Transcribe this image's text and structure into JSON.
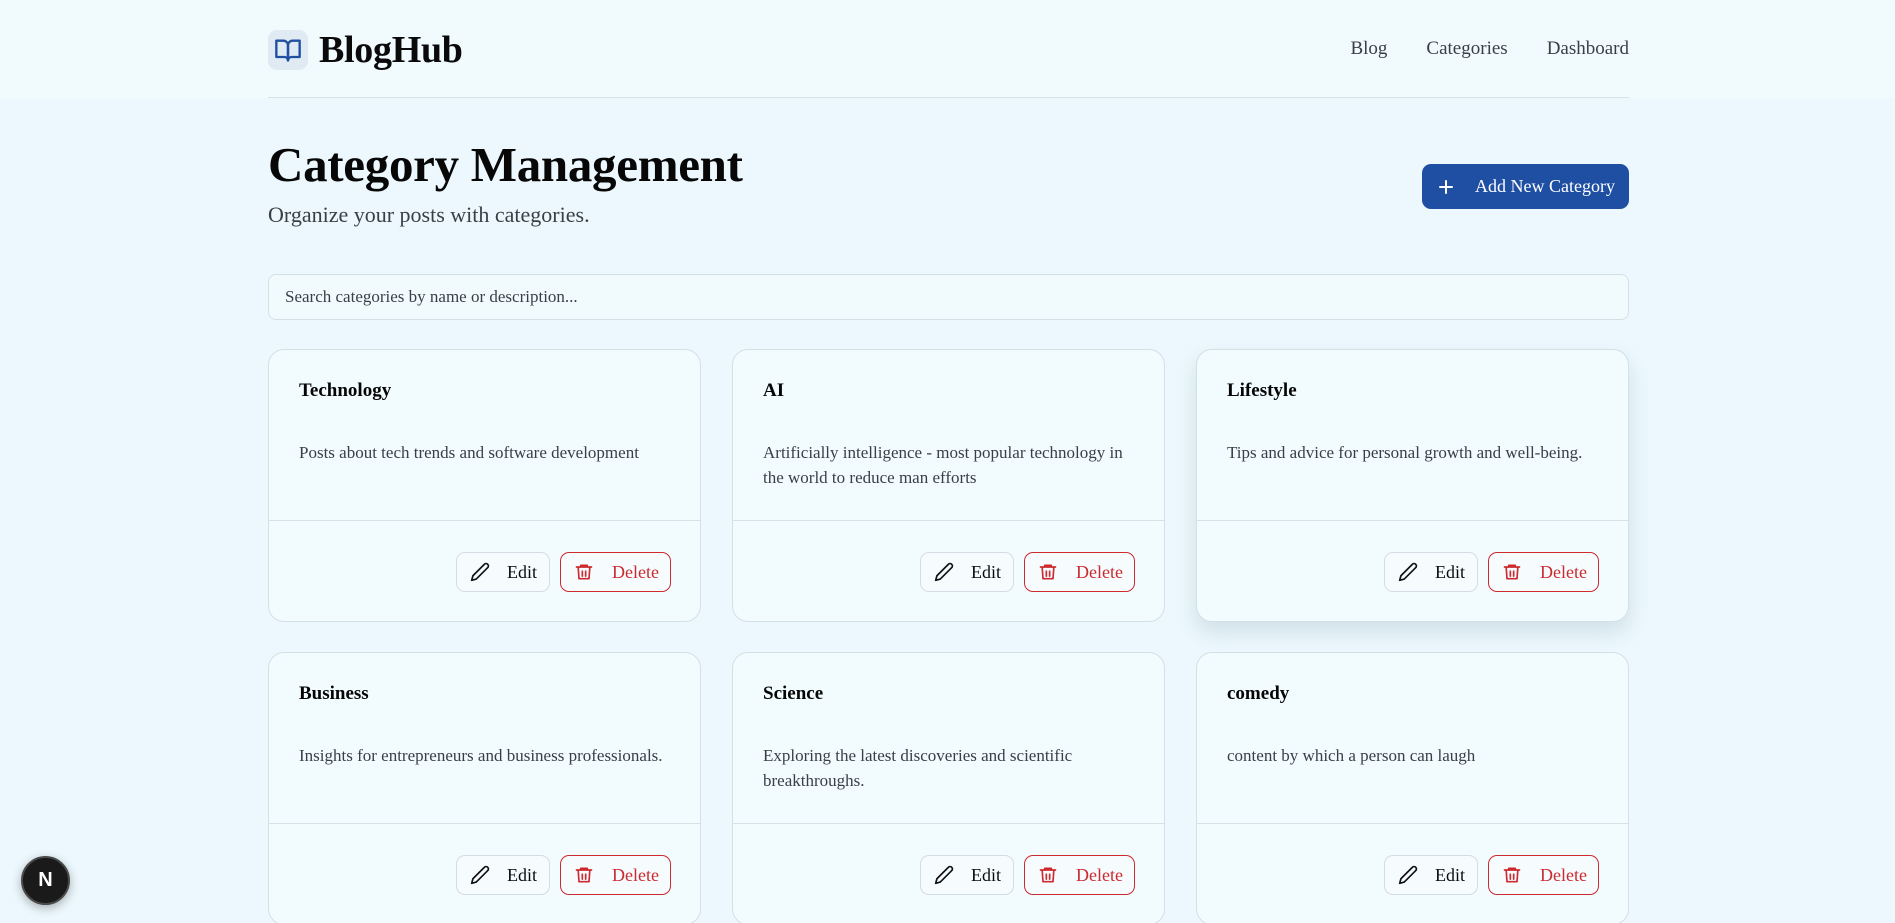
{
  "brand": {
    "name": "BlogHub",
    "icon": "book-open-icon"
  },
  "nav": {
    "items": [
      "Blog",
      "Categories",
      "Dashboard"
    ]
  },
  "header": {
    "title": "Category Management",
    "subtitle": "Organize your posts with categories.",
    "add_button": "Add New Category"
  },
  "search": {
    "placeholder": "Search categories by name or description...",
    "value": ""
  },
  "card_actions": {
    "edit": "Edit",
    "delete": "Delete"
  },
  "categories": [
    {
      "name": "Technology",
      "description": "Posts about tech trends and software development"
    },
    {
      "name": "AI",
      "description": "Artificially intelligence - most popular technology in the world to reduce man efforts"
    },
    {
      "name": "Lifestyle",
      "description": "Tips and advice for personal growth and well-being."
    },
    {
      "name": "Business",
      "description": "Insights for entrepreneurs and business professionals."
    },
    {
      "name": "Science",
      "description": "Exploring the latest discoveries and scientific breakthroughs."
    },
    {
      "name": "comedy",
      "description": "content by which a person can laugh"
    }
  ],
  "devtools_badge": {
    "label": "N"
  },
  "colors": {
    "accent": "#1e4fa3",
    "danger": "#cc2a2f",
    "background": "#ecf8fd"
  }
}
